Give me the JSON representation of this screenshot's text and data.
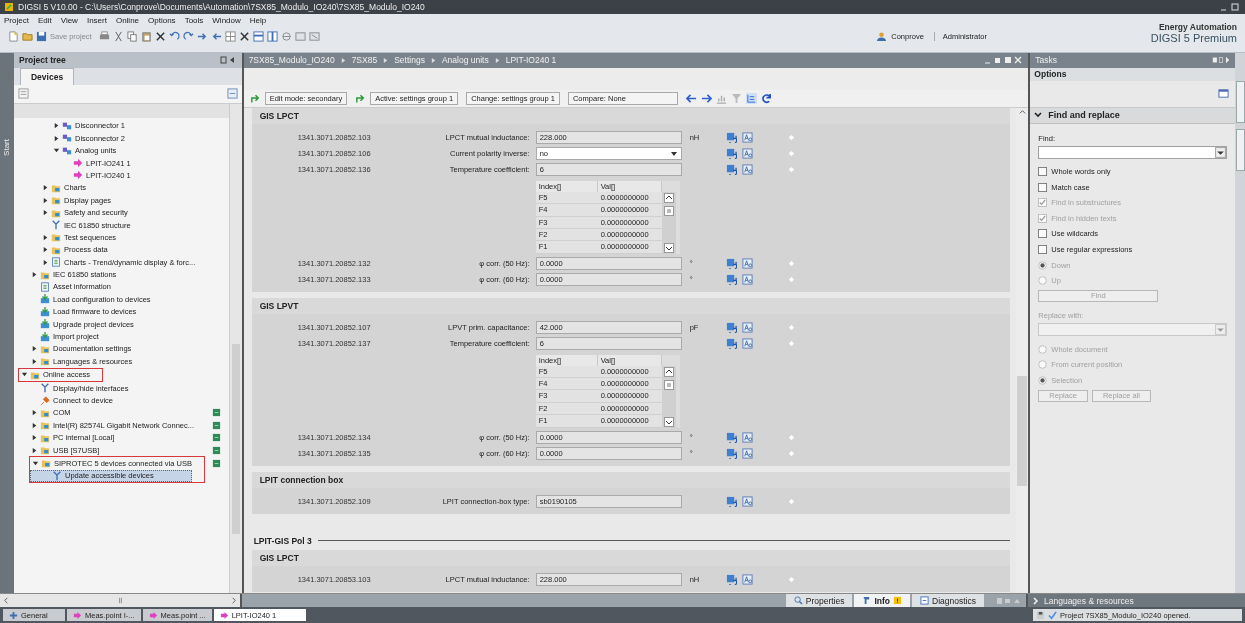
{
  "window": {
    "title": "DIGSI 5 V10.00 - C:\\Users\\Conprove\\Documents\\Automation\\7SX85_Modulo_IO240\\7SX85_Modulo_IO240"
  },
  "menu": [
    "Project",
    "Edit",
    "View",
    "Insert",
    "Online",
    "Options",
    "Tools",
    "Window",
    "Help"
  ],
  "toolbar": {
    "save_label": "Save project"
  },
  "user": {
    "name": "Conprove",
    "role": "Administrator"
  },
  "brand": {
    "line1": "Energy Automation",
    "line2": "DIGSI 5 Premium"
  },
  "side_tab": "Start",
  "project_tree": {
    "title": "Project tree",
    "tabs": [
      {
        "label": "Devices",
        "selected": true
      }
    ],
    "items": [
      {
        "kind": "continued",
        "children": [
          {
            "kind": "continued",
            "children": [
              {
                "kind": "continued",
                "children": [
                  {
                    "kind": "function",
                    "label": "Disconnector 1",
                    "expanded": false,
                    "selected": false
                  },
                  {
                    "kind": "function",
                    "label": "Disconnector 2",
                    "expanded": false,
                    "selected": false
                  },
                  {
                    "kind": "function",
                    "label": "Analog units",
                    "expanded": true,
                    "selected": false,
                    "children": [
                      {
                        "kind": "signal",
                        "label": "LPIT-IO241 1",
                        "selected": false
                      },
                      {
                        "kind": "signal",
                        "label": "LPIT-IO240 1",
                        "selected": false
                      }
                    ]
                  }
                ]
              },
              {
                "kind": "folder",
                "label": "Charts",
                "expanded": false,
                "selected": false
              },
              {
                "kind": "folder",
                "label": "Display pages",
                "expanded": false,
                "selected": false
              },
              {
                "kind": "folder",
                "label": "Safety and security",
                "expanded": false,
                "selected": false
              },
              {
                "kind": "tool",
                "label": "IEC 61850 structure",
                "selected": false
              },
              {
                "kind": "folder",
                "label": "Test sequences",
                "expanded": false,
                "selected": false
              },
              {
                "kind": "folder",
                "label": "Process data",
                "expanded": false,
                "selected": false
              },
              {
                "kind": "document",
                "label": "Charts - Trend/dynamic display & forc...",
                "expanded": false,
                "selected": false
              }
            ]
          },
          {
            "kind": "folder",
            "label": "IEC 61850 stations",
            "expanded": false,
            "selected": false
          },
          {
            "kind": "document",
            "label": "Asset information",
            "selected": false
          },
          {
            "kind": "download",
            "label": "Load configuration to devices",
            "selected": false
          },
          {
            "kind": "download",
            "label": "Load firmware to devices",
            "selected": false
          },
          {
            "kind": "download",
            "label": "Upgrade project devices",
            "selected": false
          },
          {
            "kind": "download",
            "label": "Import project",
            "selected": false
          },
          {
            "kind": "folder",
            "label": "Documentation settings",
            "expanded": false,
            "selected": false
          },
          {
            "kind": "folder",
            "label": "Languages & resources",
            "expanded": false,
            "selected": false
          }
        ]
      },
      {
        "kind": "folder",
        "label": "Online access",
        "expanded": true,
        "selected": false,
        "highlighted": true,
        "children": [
          {
            "kind": "tool",
            "label": "Display/hide interfaces",
            "selected": false
          },
          {
            "kind": "plug",
            "label": "Connect to device",
            "selected": false
          },
          {
            "kind": "folder",
            "label": "COM",
            "expanded": false,
            "selected": false,
            "link": true
          },
          {
            "kind": "folder",
            "label": "Intel(R) 82574L Gigabit Network Connec...",
            "expanded": false,
            "selected": false,
            "link": true
          },
          {
            "kind": "folder",
            "label": "PC internal [Local]",
            "expanded": false,
            "selected": false,
            "link": true
          },
          {
            "kind": "folder",
            "label": "USB [S7USB]",
            "expanded": false,
            "selected": false,
            "link": true
          },
          {
            "kind": "folder",
            "label": "SIPROTEC 5 devices connected via USB",
            "expanded": true,
            "selected": false,
            "link": true,
            "highlighted": true,
            "children": [
              {
                "kind": "tool",
                "label": "Update accessible devices",
                "selected": true,
                "highlighted": true
              }
            ]
          }
        ]
      }
    ]
  },
  "editor": {
    "breadcrumb": [
      "7SX85_Modulo_IO240",
      "7SX85",
      "Settings",
      "Analog units",
      "LPIT-IO240 1"
    ],
    "toolbar": [
      "Edit mode: secondary",
      "Active: settings group 1",
      "Change: settings group 1",
      "Compare: None"
    ],
    "groups": [
      {
        "kind": "section",
        "title": "GIS LPCT",
        "rows": [
          {
            "kind": "text",
            "id": "1341.3071.20852.103",
            "label": "LPCT mutual inductance:",
            "value": "228.000",
            "unit": "nH"
          },
          {
            "kind": "select",
            "id": "1341.3071.20852.106",
            "label": "Current polarity inverse:",
            "value": "no"
          },
          {
            "kind": "text",
            "id": "1341.3071.20852.136",
            "label": "Temperature coefficient:",
            "value": "6"
          },
          {
            "kind": "table",
            "columns": [
              "Index[]",
              "Val[]"
            ],
            "rows": [
              [
                "F5",
                "0.0000000000"
              ],
              [
                "F4",
                "0.0000000000"
              ],
              [
                "F3",
                "0.0000000000"
              ],
              [
                "F2",
                "0.0000000000"
              ],
              [
                "F1",
                "0.0000000000"
              ]
            ]
          },
          {
            "kind": "text",
            "id": "1341.3071.20852.132",
            "label": "φ corr. (50 Hz):",
            "value": "0.0000",
            "unit": "°"
          },
          {
            "kind": "text",
            "id": "1341.3071.20852.133",
            "label": "φ corr. (60 Hz):",
            "value": "0.0000",
            "unit": "°"
          }
        ]
      },
      {
        "kind": "section",
        "title": "GIS LPVT",
        "rows": [
          {
            "kind": "text",
            "id": "1341.3071.20852.107",
            "label": "LPVT prim. capacitance:",
            "value": "42.000",
            "unit": "pF"
          },
          {
            "kind": "text",
            "id": "1341.3071.20852.137",
            "label": "Temperature coefficient:",
            "value": "6"
          },
          {
            "kind": "table",
            "columns": [
              "Index[]",
              "Val[]"
            ],
            "rows": [
              [
                "F5",
                "0.0000000000"
              ],
              [
                "F4",
                "0.0000000000"
              ],
              [
                "F3",
                "0.0000000000"
              ],
              [
                "F2",
                "0.0000000000"
              ],
              [
                "F1",
                "0.0000000000"
              ]
            ]
          },
          {
            "kind": "text",
            "id": "1341.3071.20852.134",
            "label": "φ corr. (50 Hz):",
            "value": "0.0000",
            "unit": "°"
          },
          {
            "kind": "text",
            "id": "1341.3071.20852.135",
            "label": "φ corr. (60 Hz):",
            "value": "0.0000",
            "unit": "°"
          }
        ]
      },
      {
        "kind": "section",
        "title": "LPIT connection box",
        "rows": [
          {
            "kind": "text",
            "id": "1341.3071.20852.109",
            "label": "LPIT connection-box type:",
            "value": "sb0190105"
          }
        ]
      },
      {
        "kind": "heading",
        "title": "LPIT-GIS Pol 3"
      },
      {
        "kind": "section",
        "title": "GIS LPCT",
        "rows": [
          {
            "kind": "text",
            "id": "1341.3071.20853.103",
            "label": "LPCT mutual inductance:",
            "value": "228.000",
            "unit": "nH"
          }
        ]
      }
    ]
  },
  "tasks": {
    "title": "Tasks",
    "options": "Options",
    "section": {
      "title": "Find and replace",
      "expanded": true
    },
    "find": {
      "label": "Find:",
      "disabled": false
    },
    "checkboxes": [
      {
        "label": "Whole words only",
        "checked": false,
        "disabled": false
      },
      {
        "label": "Match case",
        "checked": false,
        "disabled": false
      },
      {
        "label": "Find in substructures",
        "checked": true,
        "disabled": true
      },
      {
        "label": "Find in hidden texts",
        "checked": true,
        "disabled": true
      },
      {
        "label": "Use wildcards",
        "checked": false,
        "disabled": false
      },
      {
        "label": "Use regular expressions",
        "checked": false,
        "disabled": false
      }
    ],
    "direction": [
      {
        "label": "Down",
        "selected": true,
        "disabled": true
      },
      {
        "label": "Up",
        "selected": false,
        "disabled": true
      }
    ],
    "find_button": {
      "label": "Find",
      "disabled": true
    },
    "replace": {
      "label": "Replace with:",
      "disabled": true
    },
    "scope": [
      {
        "label": "Whole document",
        "selected": false,
        "disabled": true
      },
      {
        "label": "From current position",
        "selected": false,
        "disabled": true
      },
      {
        "label": "Selection",
        "selected": true,
        "disabled": true
      }
    ],
    "buttons": [
      {
        "label": "Replace",
        "disabled": true
      },
      {
        "label": "Replace all",
        "disabled": true
      }
    ]
  },
  "info_bar": {
    "tabs": [
      {
        "label": "Properties",
        "selected": false
      },
      {
        "label": "Info",
        "selected": true
      },
      {
        "label": "Diagnostics",
        "selected": false
      }
    ]
  },
  "languages_panel": {
    "title": "Languages & resources",
    "expanded": false
  },
  "taskbar": [
    {
      "label": "General",
      "selected": false
    },
    {
      "label": "Meas.point I-...",
      "selected": false
    },
    {
      "label": "Meas.point ...",
      "selected": false
    },
    {
      "label": "LPIT-IO240 1",
      "selected": true
    }
  ],
  "status": "Project 7SX85_Modulo_IO240 opened."
}
